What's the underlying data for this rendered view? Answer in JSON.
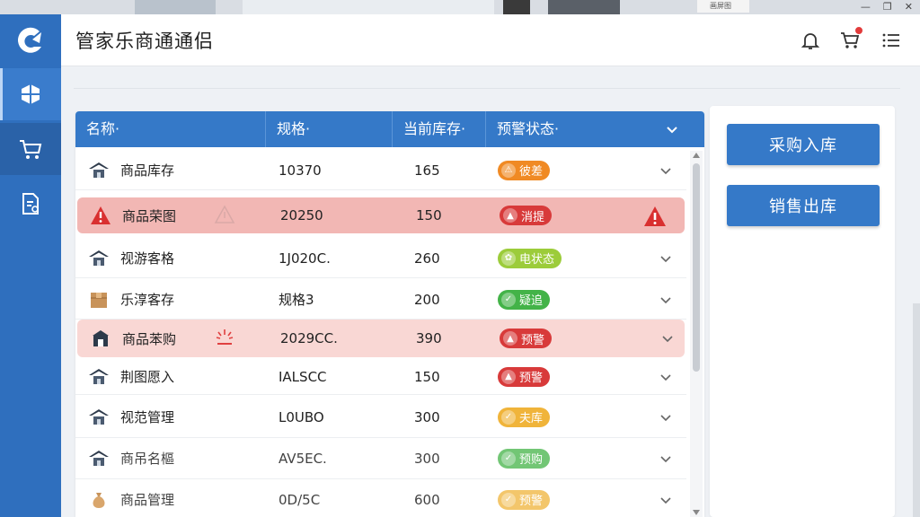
{
  "app": {
    "title": "管家乐商通通侣"
  },
  "window_tab_label": "画屏图",
  "header_icons": [
    "bell-icon",
    "cart-icon",
    "menu-icon"
  ],
  "colors": {
    "sidebar": "#2f6fbe",
    "header_bar": "#3579c8",
    "alert_row": "#f2b7b4",
    "warn_row": "#f9d7d4",
    "pill_orange": "#f08a24",
    "pill_red": "#d83a3a",
    "pill_green": "#43b348",
    "pill_lime": "#9ccc3a",
    "pill_yellow": "#f0b43a"
  },
  "sidebar": {
    "items": [
      {
        "icon": "dashboard-grid-icon"
      },
      {
        "icon": "cart-icon"
      },
      {
        "icon": "report-document-icon"
      }
    ]
  },
  "table": {
    "headers": [
      "名称·",
      "规格·",
      "当前库存·",
      "预警状态·"
    ],
    "rows": [
      {
        "icon": "warehouse-icon",
        "name": "商品库存",
        "spec": "10370",
        "stock": "165",
        "status": "彼差",
        "status_color": "orange",
        "highlight": "none"
      },
      {
        "icon": "warning-icon",
        "name": "商品荣图",
        "spec": "20250",
        "stock": "150",
        "status": "消提",
        "status_color": "red",
        "highlight": "alert"
      },
      {
        "icon": "warehouse-icon",
        "name": "视游客格",
        "spec": "1J020C.",
        "stock": "260",
        "status": "电状态",
        "status_color": "lime",
        "highlight": "none"
      },
      {
        "icon": "box-icon",
        "name": "乐淳客存",
        "spec": "规格3",
        "stock": "200",
        "status": "疑追",
        "status_color": "green",
        "highlight": "none"
      },
      {
        "icon": "store-icon",
        "name": "商品苯购",
        "spec": "2029CC.",
        "stock": "390",
        "status": "预警",
        "status_color": "red",
        "highlight": "warn"
      },
      {
        "icon": "warehouse-icon",
        "name": "荆图愿入",
        "spec": "IALSCC",
        "stock": "150",
        "status": "预警",
        "status_color": "red",
        "highlight": "none"
      },
      {
        "icon": "warehouse-icon",
        "name": "视范管理",
        "spec": "L0UBO",
        "stock": "300",
        "status": "夫库",
        "status_color": "yellow",
        "highlight": "none"
      },
      {
        "icon": "warehouse-icon",
        "name": "商吊名樞",
        "spec": "AV5EC.",
        "stock": "300",
        "status": "预购",
        "status_color": "green",
        "highlight": "none"
      },
      {
        "icon": "money-bag-icon",
        "name": "商品管理",
        "spec": "0D/5C",
        "stock": "600",
        "status": "预警",
        "status_color": "yellow",
        "highlight": "none"
      }
    ]
  },
  "actions": {
    "purchase_in": "采购入库",
    "sales_out": "销售出库"
  }
}
